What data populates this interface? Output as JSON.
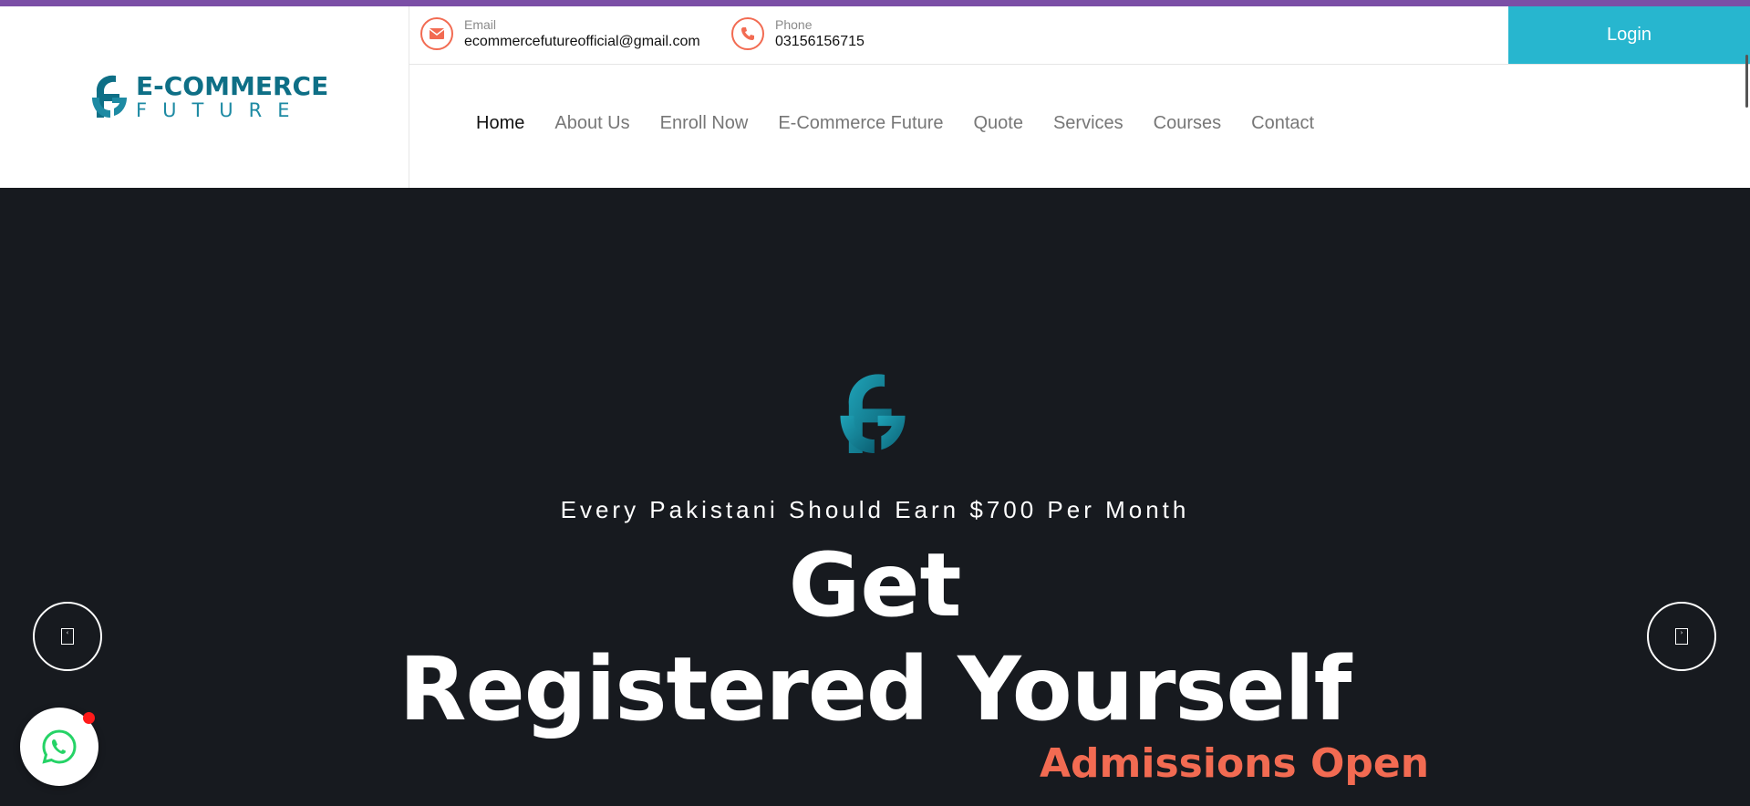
{
  "colors": {
    "accent_bar": "#7b4fa6",
    "brand_teal": "#0e6f86",
    "login_bg": "#27b6cf",
    "contact_icon": "#f26b52",
    "hero_bg": "#171a1f",
    "admissions": "#f26b52"
  },
  "logo": {
    "title": "E-COMMERCE",
    "subtitle": "FUTURE"
  },
  "contact": {
    "email": {
      "icon": "envelope-icon",
      "label": "Email",
      "value": "ecommercefutureofficial@gmail.com"
    },
    "phone": {
      "icon": "phone-icon",
      "label": "Phone",
      "value": "03156156715"
    }
  },
  "login_label": "Login",
  "nav": [
    {
      "label": "Home",
      "active": true
    },
    {
      "label": "About Us",
      "active": false
    },
    {
      "label": "Enroll Now",
      "active": false
    },
    {
      "label": "E-Commerce Future",
      "active": false
    },
    {
      "label": "Quote",
      "active": false
    },
    {
      "label": "Services",
      "active": false
    },
    {
      "label": "Courses",
      "active": false
    },
    {
      "label": "Contact",
      "active": false
    }
  ],
  "hero": {
    "tagline": "Every Pakistani Should Earn $700 Per Month",
    "title_line1": "Get",
    "title_line2": "Registered Yourself",
    "badge": "Admissions Open"
  },
  "icons": {
    "slider_prev": "arrow-left-icon",
    "slider_next": "arrow-right-icon",
    "chat": "whatsapp-icon"
  }
}
